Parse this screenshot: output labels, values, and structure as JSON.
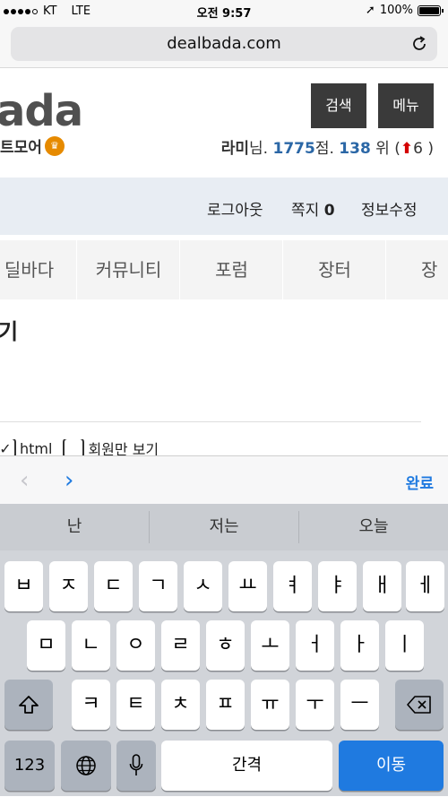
{
  "status_bar": {
    "carrier": "KT",
    "network": "LTE",
    "time": "오전 9:57",
    "battery": "100%"
  },
  "browser": {
    "url": "dealbada.com"
  },
  "site": {
    "logo_text": "ada",
    "logo_sub": "트모어",
    "search_button": "검색",
    "menu_button": "메뉴",
    "user": {
      "name": "라미",
      "suffix_name": "님. ",
      "points": "1775",
      "suffix_points": "점. ",
      "rank": "138",
      "suffix_rank": " 위 (",
      "change": "6",
      "close": " )"
    },
    "account_links": {
      "logout": "로그아웃",
      "messages_label": "쪽지",
      "messages_count": "0",
      "edit_profile": "정보수정"
    },
    "nav_tabs": [
      "딜바다",
      "커뮤니티",
      "포럼",
      "장터",
      "장"
    ],
    "heading": "기",
    "options": {
      "html_label": "html",
      "members_only_label": "회원만 보기"
    }
  },
  "accessory": {
    "done": "완료"
  },
  "keyboard": {
    "suggestions": [
      "난",
      "저는",
      "오늘"
    ],
    "row1": [
      "ㅂ",
      "ㅈ",
      "ㄷ",
      "ㄱ",
      "ㅅ",
      "ㅛ",
      "ㅕ",
      "ㅑ",
      "ㅐ",
      "ㅔ"
    ],
    "row2": [
      "ㅁ",
      "ㄴ",
      "ㅇ",
      "ㄹ",
      "ㅎ",
      "ㅗ",
      "ㅓ",
      "ㅏ",
      "ㅣ"
    ],
    "row3": [
      "ㅋ",
      "ㅌ",
      "ㅊ",
      "ㅍ",
      "ㅠ",
      "ㅜ",
      "ㅡ"
    ],
    "numbers_key": "123",
    "space_key": "간격",
    "go_key": "이동"
  },
  "colors": {
    "accent": "#1f7ae0",
    "stat_number": "#2b67a6",
    "rank_up": "#d40000",
    "account_bar": "#e8edf3"
  }
}
